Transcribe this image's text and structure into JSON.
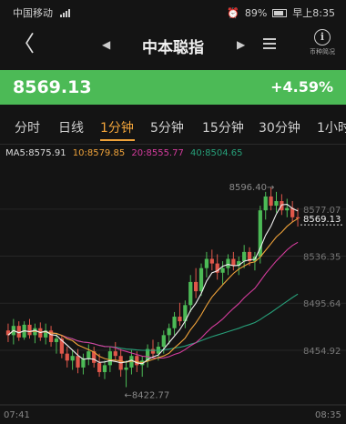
{
  "status_bar": {
    "carrier": "中国移动",
    "battery": "89%",
    "time": "早上8:35"
  },
  "nav": {
    "back_icon": "chevron-left-icon",
    "title": "中本聪指",
    "info_label": "币种简况"
  },
  "price": {
    "last": "8569.13",
    "change": "+4.59%",
    "color": "#4cba56"
  },
  "tabs": [
    {
      "label": "分时",
      "active": false
    },
    {
      "label": "日线",
      "active": false
    },
    {
      "label": "1分钟",
      "active": true
    },
    {
      "label": "5分钟",
      "active": false
    },
    {
      "label": "15分钟",
      "active": false
    },
    {
      "label": "30分钟",
      "active": false
    },
    {
      "label": "1小时",
      "active": false
    }
  ],
  "ma_legend": {
    "ma5": "MA5:8575.91",
    "ma10": "10:8579.85",
    "ma20": "20:8555.77",
    "ma40": "40:8504.65"
  },
  "chart_data": {
    "type": "candlestick",
    "x_start_label": "07:41",
    "x_end_label": "08:35",
    "y_ticks": [
      8577.07,
      8536.35,
      8495.64,
      8454.92
    ],
    "y_tick_labels": [
      "8577.07",
      "8536.35",
      "8495.64",
      "8454.92"
    ],
    "ylim": [
      8410,
      8610
    ],
    "max_label": "8596.40→",
    "min_label": "←8422.77",
    "current_price_label": "8569.13",
    "colors": {
      "up": "#4cba56",
      "down": "#e0574a",
      "ma5": "#f0f0f0",
      "ma10": "#f0a33a",
      "ma20": "#d63c9e",
      "ma40": "#27a07a"
    },
    "candles": [
      [
        8472,
        8478,
        8462,
        8468
      ],
      [
        8468,
        8482,
        8460,
        8476
      ],
      [
        8476,
        8480,
        8463,
        8466
      ],
      [
        8466,
        8480,
        8464,
        8477
      ],
      [
        8477,
        8482,
        8465,
        8468
      ],
      [
        8468,
        8478,
        8461,
        8474
      ],
      [
        8474,
        8479,
        8463,
        8466
      ],
      [
        8466,
        8478,
        8460,
        8472
      ],
      [
        8472,
        8476,
        8458,
        8462
      ],
      [
        8462,
        8470,
        8452,
        8465
      ],
      [
        8465,
        8468,
        8448,
        8452
      ],
      [
        8452,
        8458,
        8440,
        8446
      ],
      [
        8446,
        8455,
        8438,
        8450
      ],
      [
        8450,
        8456,
        8435,
        8440
      ],
      [
        8440,
        8452,
        8434,
        8448
      ],
      [
        8448,
        8460,
        8442,
        8454
      ],
      [
        8454,
        8458,
        8440,
        8444
      ],
      [
        8444,
        8452,
        8432,
        8436
      ],
      [
        8436,
        8446,
        8430,
        8442
      ],
      [
        8442,
        8458,
        8436,
        8454
      ],
      [
        8454,
        8462,
        8446,
        8450
      ],
      [
        8450,
        8456,
        8432,
        8438
      ],
      [
        8438,
        8446,
        8423,
        8440
      ],
      [
        8440,
        8455,
        8434,
        8450
      ],
      [
        8450,
        8454,
        8436,
        8442
      ],
      [
        8442,
        8450,
        8432,
        8446
      ],
      [
        8446,
        8460,
        8440,
        8456
      ],
      [
        8456,
        8464,
        8448,
        8452
      ],
      [
        8452,
        8462,
        8446,
        8458
      ],
      [
        8458,
        8472,
        8452,
        8468
      ],
      [
        8468,
        8478,
        8460,
        8474
      ],
      [
        8474,
        8488,
        8468,
        8484
      ],
      [
        8484,
        8496,
        8476,
        8480
      ],
      [
        8480,
        8498,
        8474,
        8494
      ],
      [
        8494,
        8520,
        8488,
        8514
      ],
      [
        8514,
        8526,
        8500,
        8506
      ],
      [
        8506,
        8530,
        8502,
        8526
      ],
      [
        8526,
        8540,
        8518,
        8534
      ],
      [
        8534,
        8542,
        8524,
        8530
      ],
      [
        8530,
        8538,
        8516,
        8522
      ],
      [
        8522,
        8532,
        8512,
        8526
      ],
      [
        8526,
        8538,
        8520,
        8534
      ],
      [
        8534,
        8540,
        8524,
        8528
      ],
      [
        8528,
        8536,
        8520,
        8532
      ],
      [
        8532,
        8546,
        8526,
        8540
      ],
      [
        8540,
        8544,
        8528,
        8532
      ],
      [
        8532,
        8540,
        8524,
        8536
      ],
      [
        8536,
        8580,
        8530,
        8576
      ],
      [
        8576,
        8592,
        8568,
        8588
      ],
      [
        8588,
        8596,
        8576,
        8580
      ],
      [
        8580,
        8592,
        8574,
        8584
      ],
      [
        8584,
        8590,
        8572,
        8576
      ],
      [
        8576,
        8586,
        8570,
        8578
      ],
      [
        8578,
        8584,
        8566,
        8570
      ],
      [
        8570,
        8578,
        8562,
        8569
      ]
    ]
  }
}
